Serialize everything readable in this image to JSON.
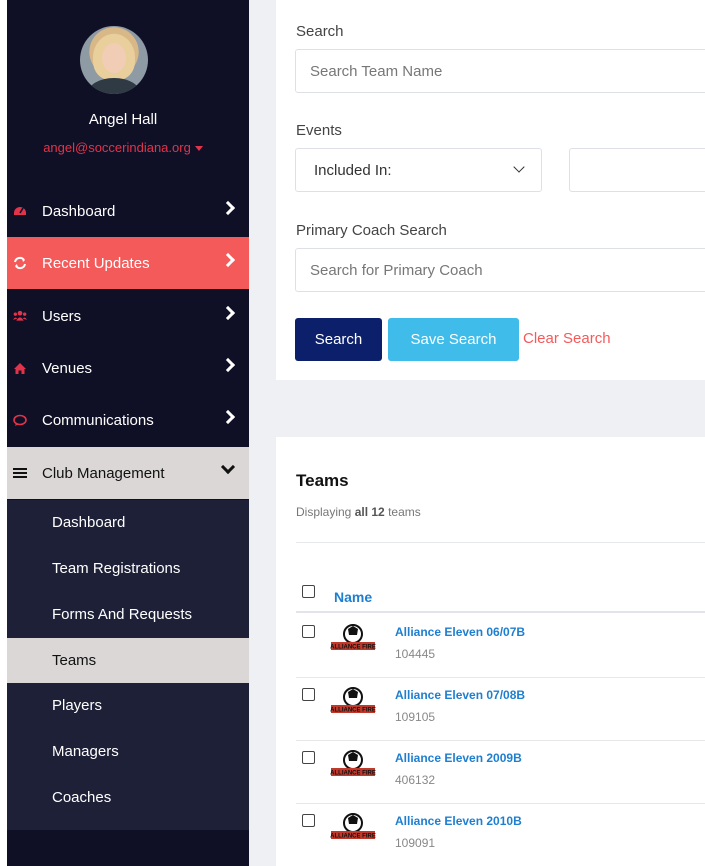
{
  "profile": {
    "name": "Angel Hall",
    "email": "angel@soccerindiana.org"
  },
  "nav": [
    {
      "label": "Dashboard",
      "icon": "dashboard-icon"
    },
    {
      "label": "Recent Updates",
      "icon": "refresh-icon"
    },
    {
      "label": "Users",
      "icon": "users-icon"
    },
    {
      "label": "Venues",
      "icon": "home-icon"
    },
    {
      "label": "Communications",
      "icon": "chat-icon"
    },
    {
      "label": "Club Management",
      "icon": "list-icon"
    }
  ],
  "club_menu": [
    {
      "label": "Dashboard"
    },
    {
      "label": "Team Registrations"
    },
    {
      "label": "Forms And Requests"
    },
    {
      "label": "Teams"
    },
    {
      "label": "Players"
    },
    {
      "label": "Managers"
    },
    {
      "label": "Coaches"
    }
  ],
  "search": {
    "label": "Search",
    "placeholder": "Search Team Name",
    "events_label": "Events",
    "events_select": "Included In:",
    "coach_label": "Primary Coach Search",
    "coach_placeholder": "Search for Primary Coach",
    "search_button": "Search",
    "save_button": "Save Search",
    "clear_link": "Clear Search"
  },
  "teams": {
    "title": "Teams",
    "subtitle_prefix": "Displaying",
    "subtitle_bold": "all 12",
    "subtitle_suffix": "teams",
    "column_name": "Name",
    "logo_text": "ALLIANCE FIRE",
    "rows": [
      {
        "name": "Alliance Eleven 06/07B",
        "id": "104445"
      },
      {
        "name": "Alliance Eleven 07/08B",
        "id": "109105"
      },
      {
        "name": "Alliance Eleven 2009B",
        "id": "406132"
      },
      {
        "name": "Alliance Eleven 2010B",
        "id": "109091"
      }
    ]
  },
  "colors": {
    "sidebar": "#0f1026",
    "accent_red": "#f45a5a",
    "link_blue": "#1e7fd0",
    "search_button": "#0c1f6b",
    "save_button": "#3fbce9"
  }
}
